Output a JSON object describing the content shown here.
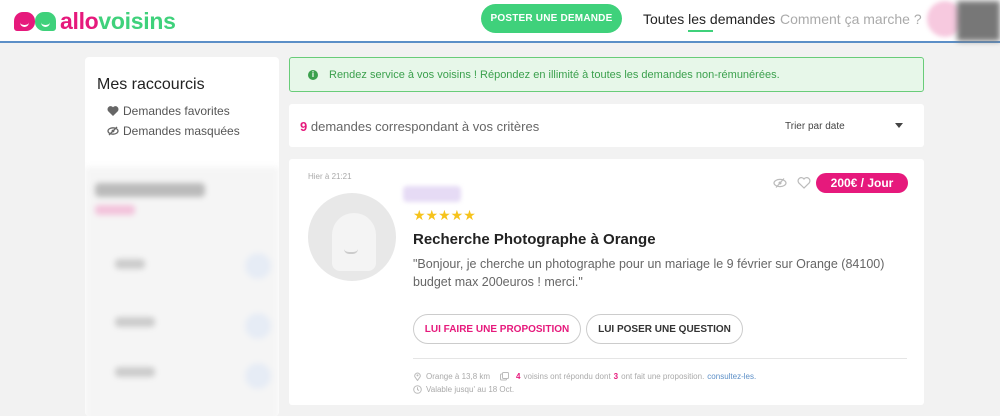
{
  "colors": {
    "brand_pink": "#e6197c",
    "brand_green": "#3fd17b",
    "success_green": "#3ba04d",
    "link_blue": "#5c8fc7",
    "star_yellow": "#f6c31c"
  },
  "header": {
    "logo_part1": "allo",
    "logo_part2": "voisins",
    "post_button": "POSTER UNE DEMANDE",
    "nav_all": "Toutes les demandes",
    "nav_how": "Comment ça marche ?"
  },
  "sidebar": {
    "title": "Mes raccourcis",
    "items": [
      {
        "label": "Demandes favorites",
        "icon": "heart-icon"
      },
      {
        "label": "Demandes masquées",
        "icon": "eye-slash-icon"
      }
    ]
  },
  "banner": {
    "icon": "info-icon",
    "text": "Rendez service à vos voisins ! Répondez en illimité à toutes les demandes non-rémunérées."
  },
  "filter": {
    "count": "9",
    "count_text": "demandes correspondant à vos critères",
    "sort_label": "Trier par date"
  },
  "card": {
    "date": "Hier à 21:21",
    "rating": 5,
    "stars": "★★★★★",
    "title": "Recherche Photographe à Orange",
    "description": "\"Bonjour, je cherche un photographe pour un mariage le 9 février sur Orange (84100) budget max 200euros ! merci.\"",
    "price": "200€ / Jour",
    "btn_proposal": "LUI FAIRE UNE PROPOSITION",
    "btn_question": "LUI POSER UNE QUESTION",
    "location": "Orange à 13,8 km",
    "responded_count": "4",
    "responded_text_1": "voisins ont répondu dont",
    "proposal_count": "3",
    "responded_text_2": "ont fait une proposition.",
    "consult_link": "consultez-les.",
    "valid_until": "Valable jusqu' au 18 Oct."
  }
}
